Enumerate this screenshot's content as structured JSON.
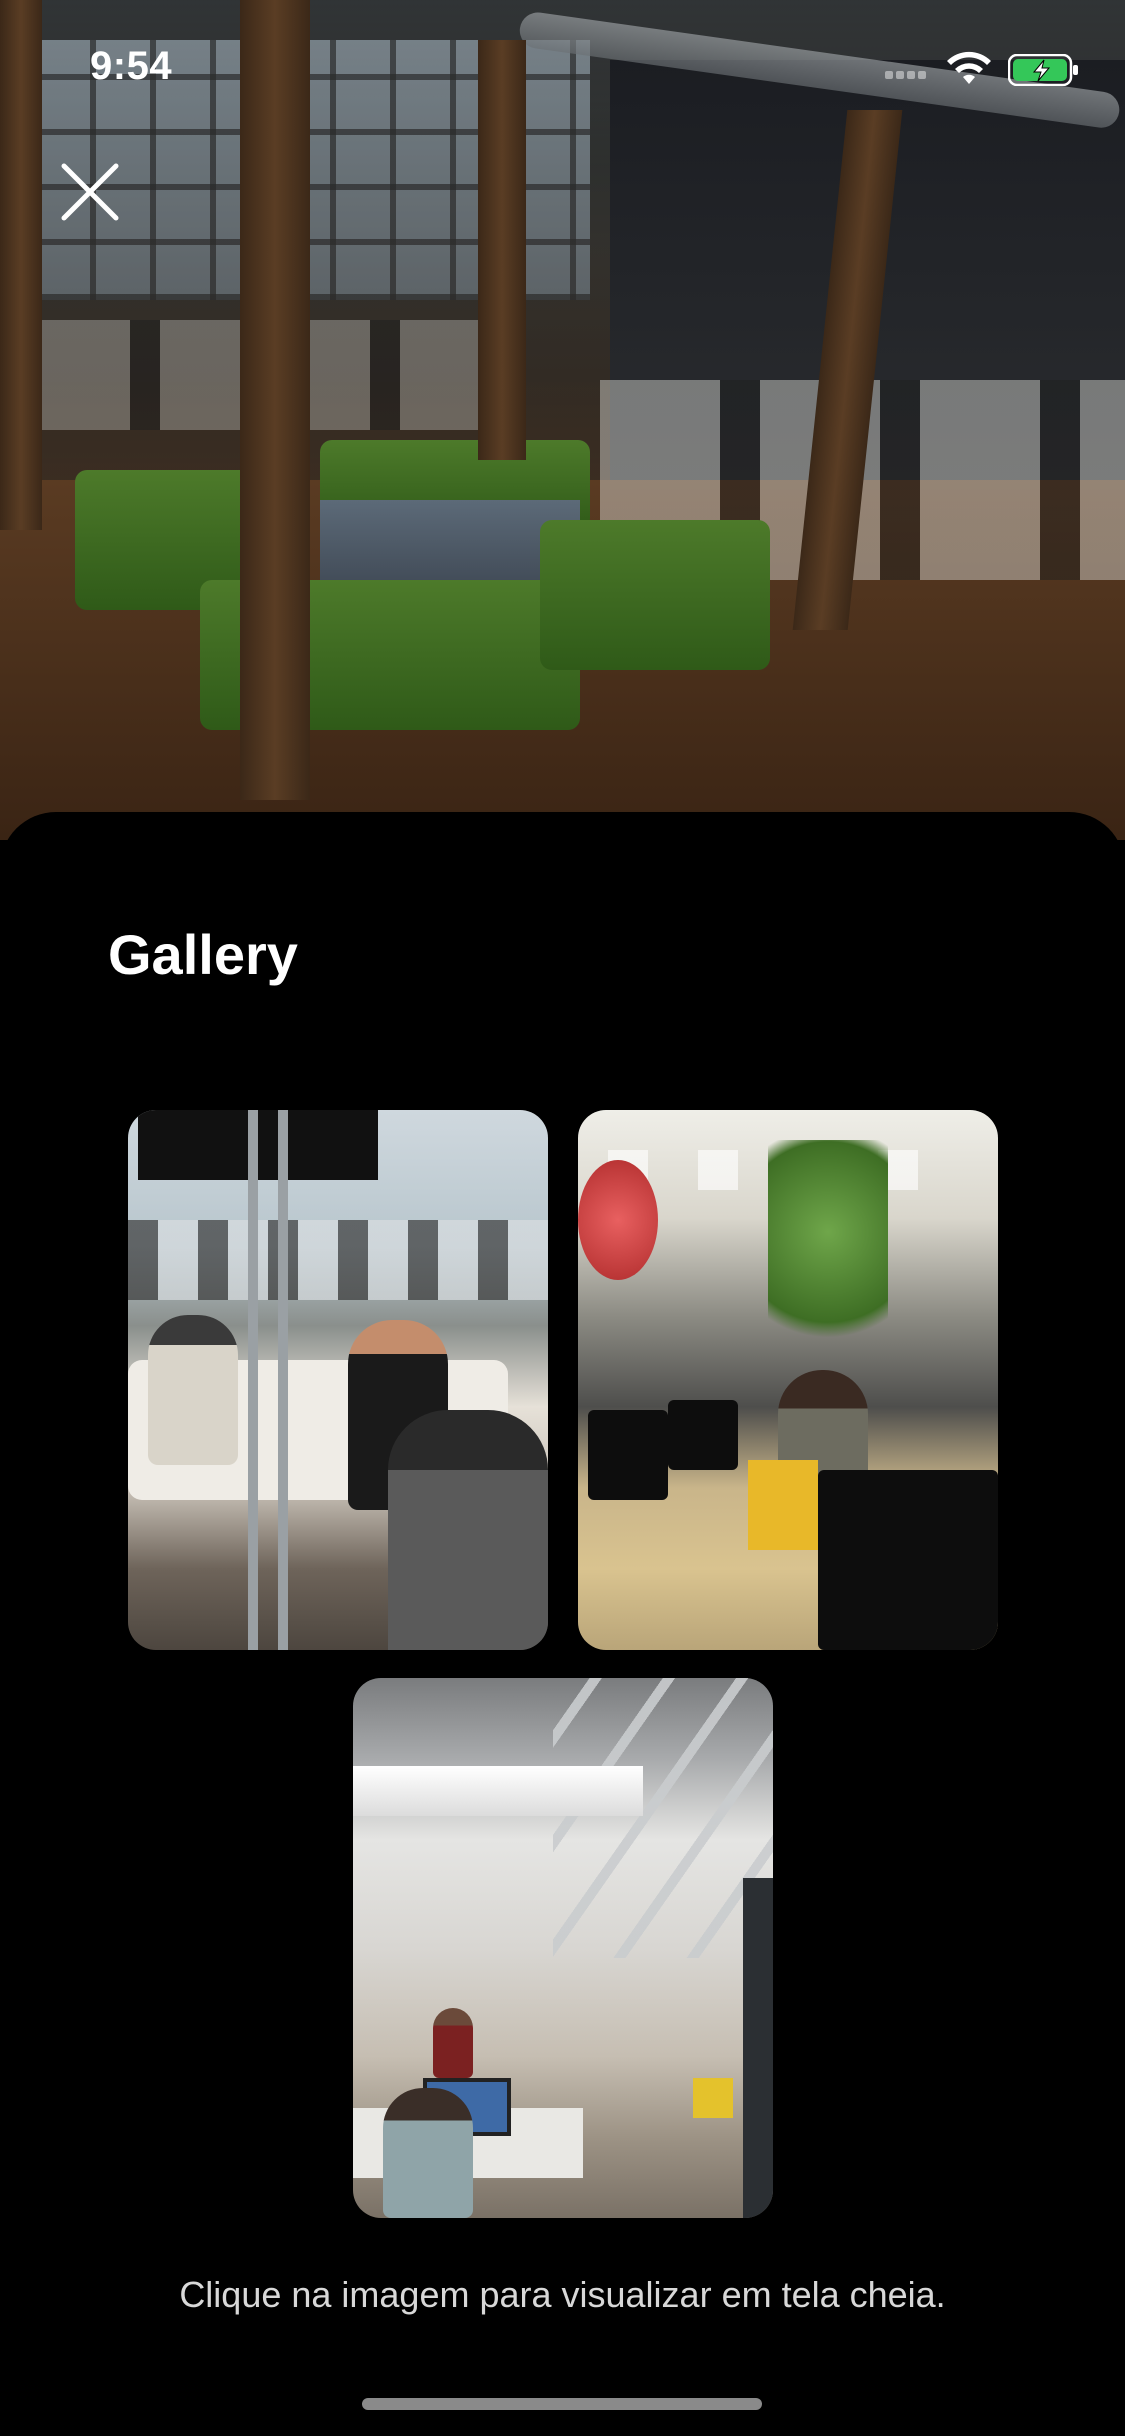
{
  "status_bar": {
    "time": "9:54"
  },
  "hero": {
    "icon": "close-icon"
  },
  "gallery": {
    "title": "Gallery",
    "images": [
      {
        "name": "studio-interview-photo"
      },
      {
        "name": "open-office-photo"
      },
      {
        "name": "industrial-office-photo"
      }
    ],
    "caption": "Clique na imagem para visualizar em tela cheia."
  },
  "colors": {
    "background": "#000000",
    "text": "#ffffff",
    "caption": "#d8d8d8",
    "battery_fill": "#34c759"
  }
}
